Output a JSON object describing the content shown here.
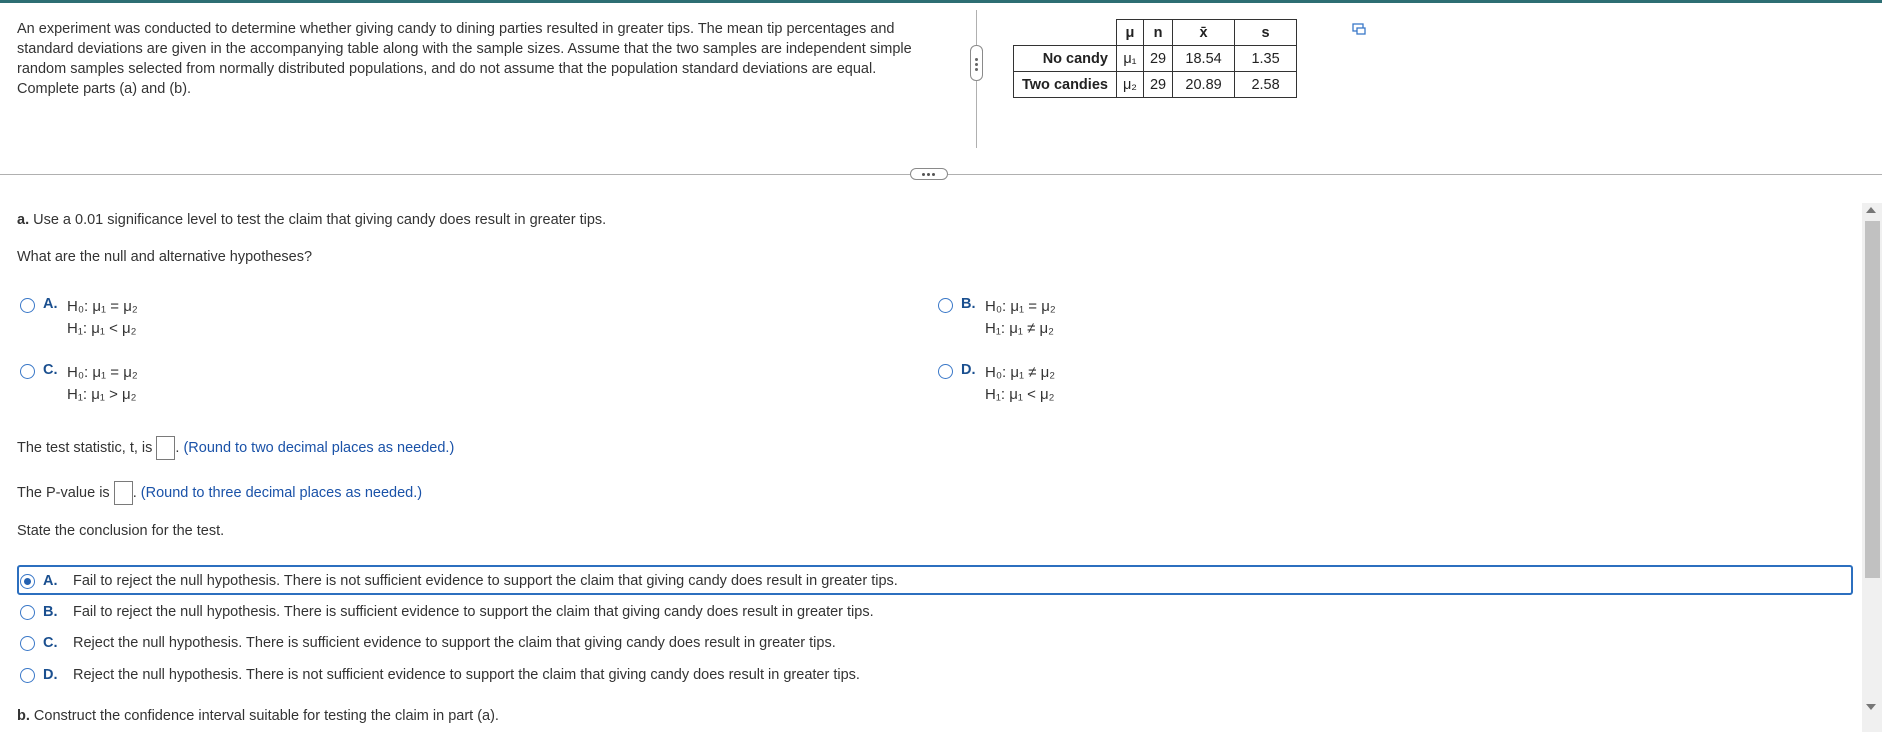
{
  "intro_text": "An experiment was conducted to determine whether giving candy to dining parties resulted in greater tips. The mean tip percentages and standard deviations are given in the accompanying table along with the sample sizes. Assume that the two samples are independent simple random samples selected from normally distributed populations, and do not assume that the population standard deviations are equal. Complete parts (a) and (b).",
  "table": {
    "headers": [
      "μ",
      "n",
      "x̄",
      "s"
    ],
    "rows": [
      {
        "label": "No candy",
        "mu": "μ₁",
        "n": "29",
        "xbar": "18.54",
        "s": "1.35"
      },
      {
        "label": "Two candies",
        "mu": "μ₂",
        "n": "29",
        "xbar": "20.89",
        "s": "2.58"
      }
    ]
  },
  "part_a": {
    "prompt_bold": "a.",
    "prompt": " Use a 0.01 significance level to test the claim that giving candy does result in greater tips.",
    "question": "What are the null and alternative hypotheses?",
    "options": [
      {
        "letter": "A.",
        "h0": "H₀: μ₁ = μ₂",
        "h1": "H₁: μ₁ < μ₂"
      },
      {
        "letter": "B.",
        "h0": "H₀: μ₁ = μ₂",
        "h1": "H₁: μ₁ ≠ μ₂"
      },
      {
        "letter": "C.",
        "h0": "H₀: μ₁ = μ₂",
        "h1": "H₁: μ₁ > μ₂"
      },
      {
        "letter": "D.",
        "h0": "H₀: μ₁ ≠ μ₂",
        "h1": "H₁: μ₁ < μ₂"
      }
    ],
    "test_stat_label": "The test statistic, t, is",
    "test_stat_hint": "(Round to two decimal places as needed.)",
    "pvalue_label": "The P-value is",
    "pvalue_hint": "(Round to three decimal places as needed.)",
    "conclusion_prompt": "State the conclusion for the test.",
    "conclusions": [
      {
        "letter": "A.",
        "text": "Fail to reject the null hypothesis. There is not sufficient evidence to support the claim that giving candy does result in greater tips.",
        "selected": true
      },
      {
        "letter": "B.",
        "text": "Fail to reject the null hypothesis. There is sufficient evidence to support the claim that giving candy does result in greater tips.",
        "selected": false
      },
      {
        "letter": "C.",
        "text": "Reject the null hypothesis. There is sufficient evidence to support the claim that giving candy does result in greater tips.",
        "selected": false
      },
      {
        "letter": "D.",
        "text": "Reject the null hypothesis. There is not sufficient evidence to support the claim that giving candy does result in greater tips.",
        "selected": false
      }
    ]
  },
  "part_b": {
    "prompt_bold": "b.",
    "prompt": " Construct the confidence interval suitable for testing the claim in part (a)."
  },
  "colors": {
    "accent": "#2c6fbf",
    "hint": "#1a52a8",
    "topbar": "#2d6e73"
  }
}
